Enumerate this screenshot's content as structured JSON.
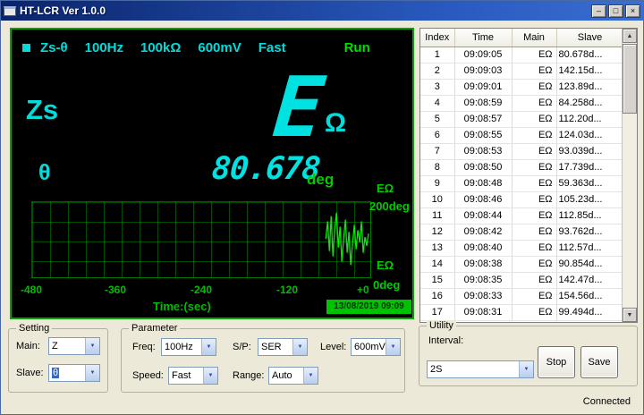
{
  "window": {
    "title": "HT-LCR Ver 1.0.0",
    "controls": {
      "minimize": "–",
      "maximize": "□",
      "close": "×"
    }
  },
  "display": {
    "status": {
      "mode": "Zs-θ",
      "freq": "100Hz",
      "range": "100kΩ",
      "level": "600mV",
      "speed": "Fast",
      "run": "Run"
    },
    "main": {
      "label": "Zs",
      "value": "E",
      "unit": "Ω"
    },
    "slave": {
      "label": "θ",
      "value": "80.678",
      "unit": "deg"
    },
    "graph": {
      "y_top_unit": "EΩ",
      "y_top": "200deg",
      "y_bottom_unit": "EΩ",
      "y_bottom": "0deg",
      "x_ticks": [
        "-480",
        "-360",
        "-240",
        "-120",
        "+0"
      ],
      "x_label": "Time:(sec)",
      "datetime": "13/08/2019 09:09",
      "waveform": [
        [
          330,
          42
        ],
        [
          332,
          22
        ],
        [
          334,
          56
        ],
        [
          336,
          16
        ],
        [
          338,
          62
        ],
        [
          340,
          30
        ],
        [
          342,
          12
        ],
        [
          344,
          52
        ],
        [
          346,
          28
        ],
        [
          348,
          68
        ],
        [
          350,
          42
        ],
        [
          352,
          20
        ],
        [
          354,
          58
        ],
        [
          356,
          34
        ],
        [
          358,
          72
        ],
        [
          360,
          48
        ],
        [
          362,
          26
        ],
        [
          364,
          54
        ],
        [
          366,
          32
        ],
        [
          368,
          46
        ],
        [
          370,
          22
        ],
        [
          372,
          58
        ],
        [
          374,
          40
        ],
        [
          376,
          50
        ],
        [
          378,
          36
        ]
      ]
    }
  },
  "table": {
    "headers": [
      "Index",
      "Time",
      "Main",
      "Slave"
    ],
    "rows": [
      [
        "1",
        "09:09:05",
        "EΩ",
        "80.678d..."
      ],
      [
        "2",
        "09:09:03",
        "EΩ",
        "142.15d..."
      ],
      [
        "3",
        "09:09:01",
        "EΩ",
        "123.89d..."
      ],
      [
        "4",
        "09:08:59",
        "EΩ",
        "84.258d..."
      ],
      [
        "5",
        "09:08:57",
        "EΩ",
        "112.20d..."
      ],
      [
        "6",
        "09:08:55",
        "EΩ",
        "124.03d..."
      ],
      [
        "7",
        "09:08:53",
        "EΩ",
        "93.039d..."
      ],
      [
        "8",
        "09:08:50",
        "EΩ",
        "17.739d..."
      ],
      [
        "9",
        "09:08:48",
        "EΩ",
        "59.363d..."
      ],
      [
        "10",
        "09:08:46",
        "EΩ",
        "105.23d..."
      ],
      [
        "11",
        "09:08:44",
        "EΩ",
        "112.85d..."
      ],
      [
        "12",
        "09:08:42",
        "EΩ",
        "93.762d..."
      ],
      [
        "13",
        "09:08:40",
        "EΩ",
        "112.57d..."
      ],
      [
        "14",
        "09:08:38",
        "EΩ",
        "90.854d..."
      ],
      [
        "15",
        "09:08:35",
        "EΩ",
        "142.47d..."
      ],
      [
        "16",
        "09:08:33",
        "EΩ",
        "154.56d..."
      ],
      [
        "17",
        "09:08:31",
        "EΩ",
        "99.494d..."
      ]
    ]
  },
  "setting": {
    "title": "Setting",
    "main_label": "Main:",
    "main_value": "Z",
    "slave_label": "Slave:",
    "slave_value": "θ"
  },
  "parameter": {
    "title": "Parameter",
    "freq_label": "Freq:",
    "freq_value": "100Hz",
    "sp_label": "S/P:",
    "sp_value": "SER",
    "level_label": "Level:",
    "level_value": "600mV",
    "speed_label": "Speed:",
    "speed_value": "Fast",
    "range_label": "Range:",
    "range_value": "Auto"
  },
  "utility": {
    "title": "Utility",
    "interval_label": "Interval:",
    "interval_value": "2S",
    "stop_label": "Stop",
    "save_label": "Save"
  },
  "status_bar": {
    "connected": "Connected"
  },
  "colors": {
    "lcd_cyan": "#00dcdc",
    "lcd_green": "#00cc00",
    "lcd_border": "#00a800",
    "titlebar_blue": "#0a246a",
    "selection_blue": "#316ac5",
    "datetime_bg": "#00c300"
  }
}
